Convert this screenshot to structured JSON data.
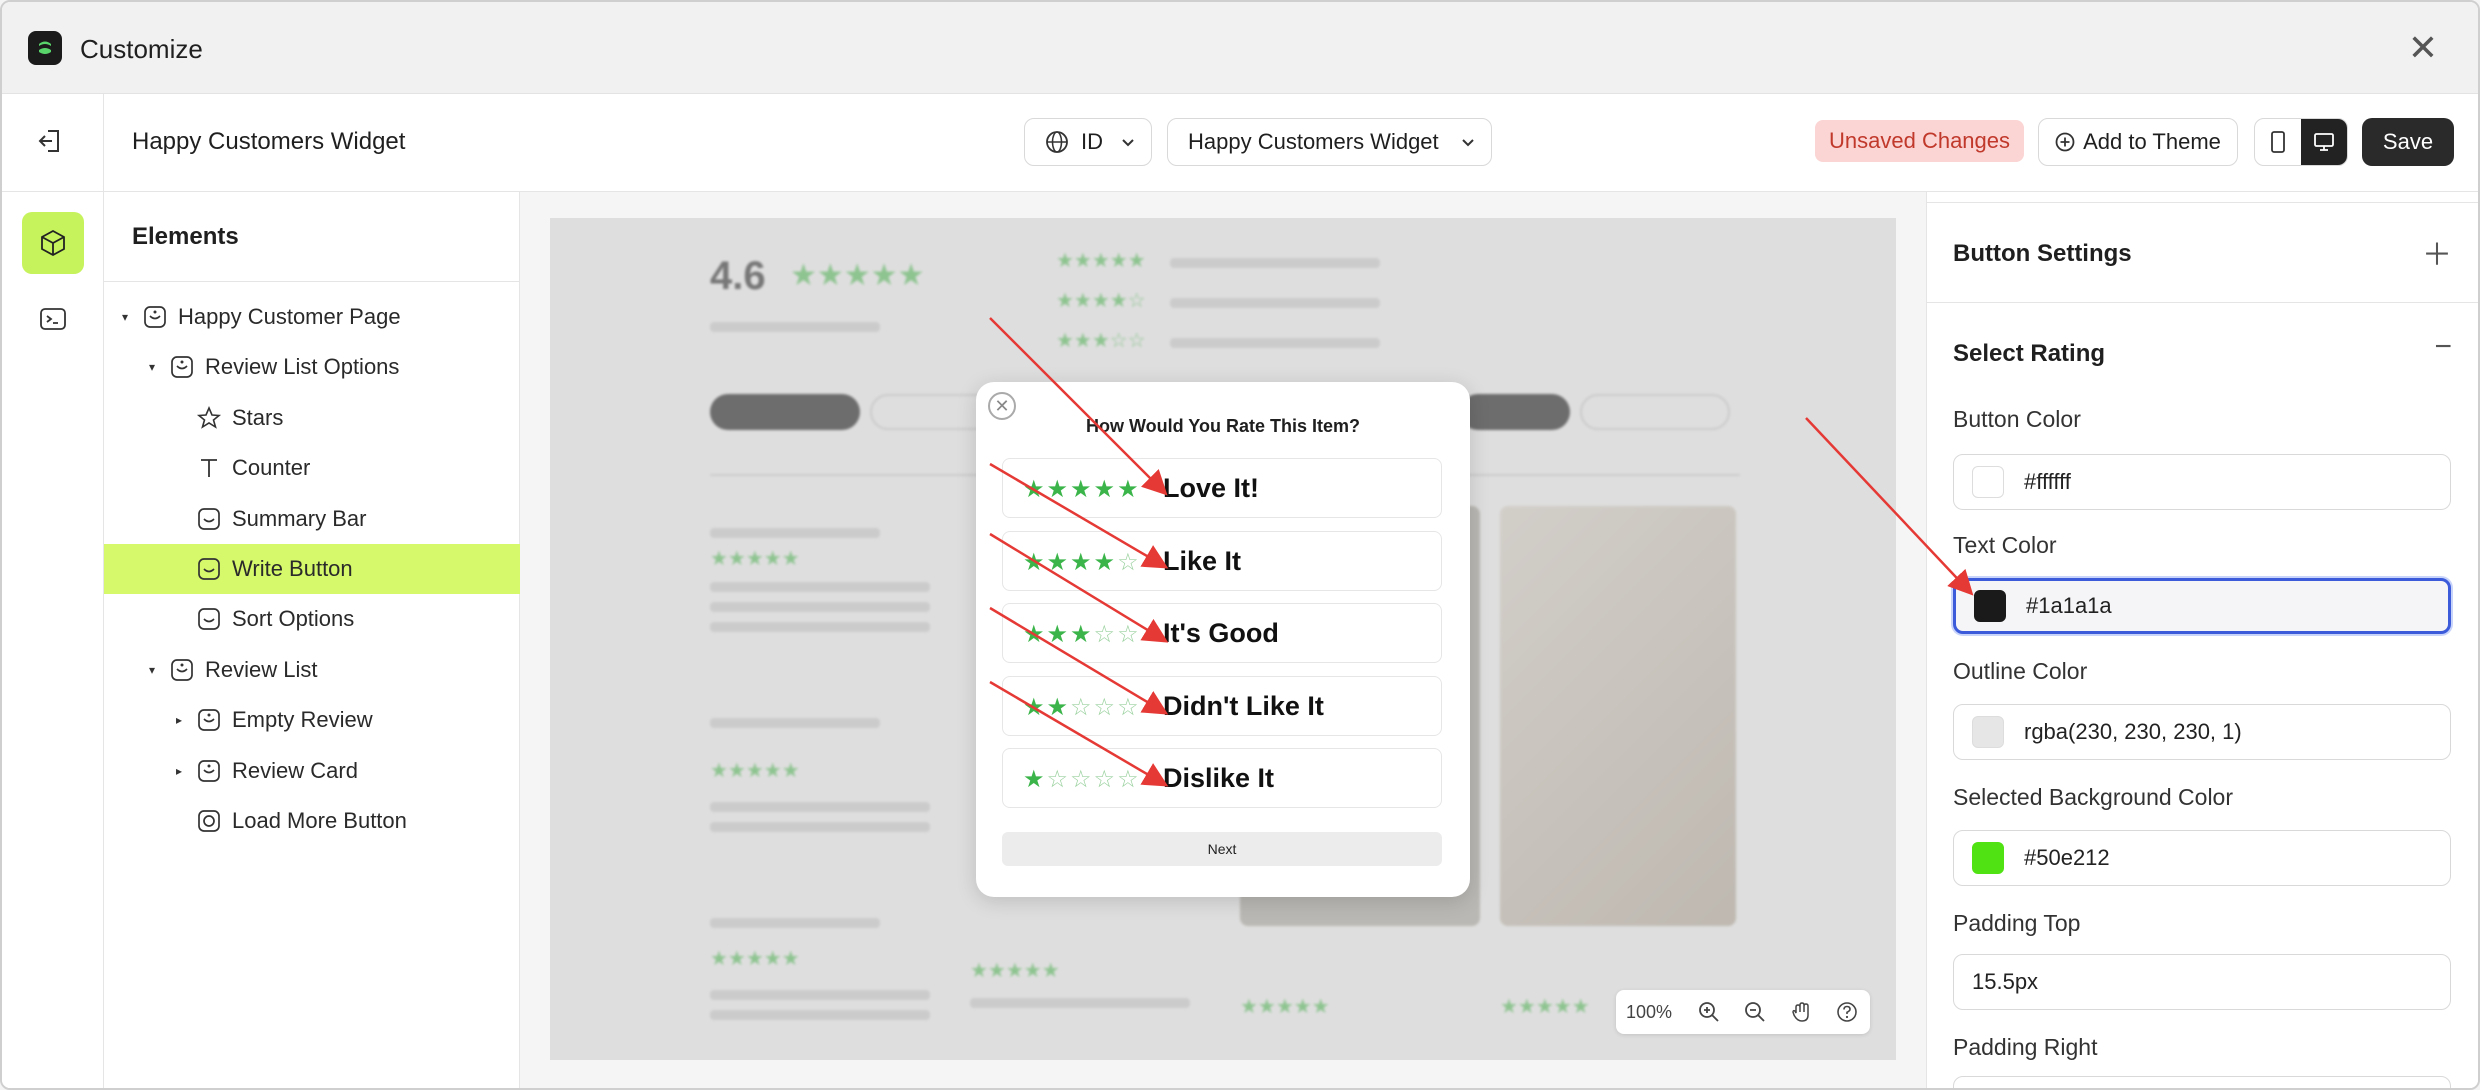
{
  "window": {
    "title": "Customize"
  },
  "toolbar": {
    "page_name": "Happy Customers Widget",
    "language": "ID",
    "page_select": "Happy Customers Widget",
    "unsaved": "Unsaved Changes",
    "add_to_theme": "Add to Theme",
    "save": "Save"
  },
  "elements": {
    "heading": "Elements",
    "tree": [
      {
        "label": "Happy Customer Page",
        "icon": "section-icon"
      },
      {
        "label": "Review List Options",
        "icon": "section-icon"
      },
      {
        "label": "Stars",
        "icon": "star-icon"
      },
      {
        "label": "Counter",
        "icon": "text-icon"
      },
      {
        "label": "Summary Bar",
        "icon": "block-icon"
      },
      {
        "label": "Write Button",
        "icon": "block-icon",
        "selected": true
      },
      {
        "label": "Sort Options",
        "icon": "block-icon"
      },
      {
        "label": "Review List",
        "icon": "section-icon"
      },
      {
        "label": "Empty Review",
        "icon": "section-icon"
      },
      {
        "label": "Review Card",
        "icon": "section-icon"
      },
      {
        "label": "Load More Button",
        "icon": "button-icon"
      }
    ]
  },
  "canvas": {
    "summary_rating": "4.6",
    "modal": {
      "title": "How Would You Rate This Item?",
      "options": [
        {
          "stars": 5,
          "label": "Love It!"
        },
        {
          "stars": 4,
          "label": "Like It"
        },
        {
          "stars": 3,
          "label": "It's Good"
        },
        {
          "stars": 2,
          "label": "Didn't Like It"
        },
        {
          "stars": 1,
          "label": "Dislike It"
        }
      ],
      "next": "Next"
    },
    "zoom": "100%"
  },
  "settings": {
    "button_settings": "Button Settings",
    "select_rating": "Select Rating",
    "button_color_label": "Button Color",
    "button_color": "#ffffff",
    "text_color_label": "Text Color",
    "text_color": "#1a1a1a",
    "outline_color_label": "Outline Color",
    "outline_color": "rgba(230, 230, 230, 1)",
    "selected_bg_label": "Selected Background Color",
    "selected_bg": "#50e212",
    "padding_top_label": "Padding Top",
    "padding_top": "15.5px",
    "padding_right_label": "Padding Right"
  },
  "colors": {
    "accent_green": "#c6f25c",
    "star_green": "#3bb54a",
    "focus_blue": "#3b5bdb",
    "annotation_red": "#e53935"
  }
}
